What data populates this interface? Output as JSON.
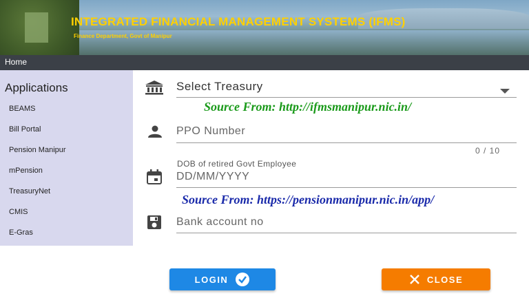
{
  "banner": {
    "title": "INTEGRATED FINANCIAL MANAGEMENT SYSTEMS (IFMS)",
    "subtitle": "Finance Department, Govt of Manipur"
  },
  "nav": {
    "home": "Home"
  },
  "sidebar": {
    "heading": "Applications",
    "items": [
      {
        "label": "BEAMS"
      },
      {
        "label": "Bill Portal"
      },
      {
        "label": "Pension Manipur"
      },
      {
        "label": "mPension"
      },
      {
        "label": "TreasuryNet"
      },
      {
        "label": "CMIS"
      },
      {
        "label": "E-Gras"
      }
    ]
  },
  "form": {
    "treasury": {
      "value": "Select Treasury",
      "icon": "bank-icon"
    },
    "ppo": {
      "placeholder": "PPO Number",
      "counter": "0 / 10",
      "icon": "person-icon"
    },
    "dob": {
      "label": "DOB of retired Govt Employee",
      "placeholder": "DD/MM/YYYY",
      "icon": "calendar-icon"
    },
    "bank": {
      "placeholder": "Bank account no",
      "icon": "save-icon"
    }
  },
  "watermarks": {
    "first": "Source From: http://ifmsmanipur.nic.in/",
    "second": "Source From: https://pensionmanipur.nic.in/app/"
  },
  "buttons": {
    "login": {
      "label": "LOGIN",
      "color": "#1e88e5"
    },
    "close": {
      "label": "CLOSE",
      "color": "#f57c00"
    }
  },
  "colors": {
    "banner_text": "#ffd000",
    "nav_bg": "#3b4047",
    "sidebar_bg": "#d8d8ee",
    "watermark_green": "#1a9a1a",
    "watermark_blue": "#1a2aaa"
  }
}
